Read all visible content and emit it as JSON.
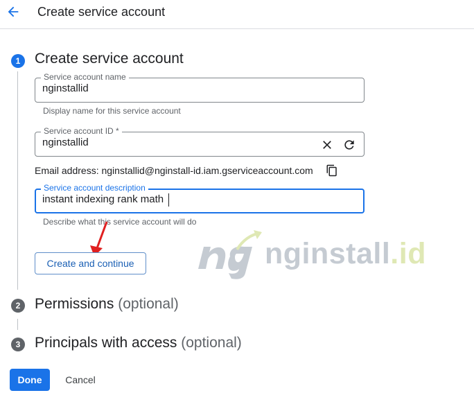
{
  "header": {
    "title": "Create service account"
  },
  "steps": [
    {
      "number": "1",
      "title": "Create service account",
      "optional": ""
    },
    {
      "number": "2",
      "title": "Permissions",
      "optional": "(optional)"
    },
    {
      "number": "3",
      "title": "Principals with access",
      "optional": "(optional)"
    }
  ],
  "form": {
    "name": {
      "label": "Service account name",
      "value": "nginstallid",
      "helper": "Display name for this service account"
    },
    "id": {
      "label": "Service account ID *",
      "value": "nginstallid"
    },
    "email": {
      "text": "Email address: nginstallid@nginstall-id.iam.gserviceaccount.com"
    },
    "description": {
      "label": "Service account description",
      "value": "instant indexing rank math",
      "helper": "Describe what this service account will do"
    },
    "create_button": "Create and continue"
  },
  "footer": {
    "done_label": "Done",
    "cancel_label": "Cancel"
  },
  "watermark": {
    "brand": "nginstall",
    "suffix": ".id"
  },
  "colors": {
    "accent": "#1a73e8",
    "arrow": "#e02020"
  }
}
